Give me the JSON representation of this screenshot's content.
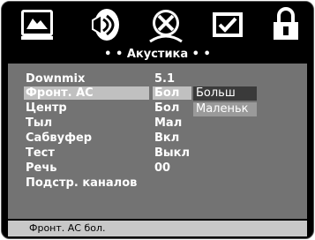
{
  "icon_bar": {
    "icons": [
      "picture-icon",
      "speaker-audio-icon",
      "disc-icon",
      "checkbox-icon",
      "lock-icon"
    ]
  },
  "menu": {
    "title": "• • Акустика • •",
    "items": [
      {
        "label": "Downmix",
        "value": "5.1"
      },
      {
        "label": "Фронт. АС",
        "value": "Бол"
      },
      {
        "label": "Центр",
        "value": "Бол"
      },
      {
        "label": "Тыл",
        "value": "Мал"
      },
      {
        "label": "Сабвуфер",
        "value": "Вкл"
      },
      {
        "label": "Тест",
        "value": "Выкл"
      },
      {
        "label": "Речь",
        "value": "00"
      },
      {
        "label": "Подстр. каналов",
        "value": ""
      }
    ],
    "options": [
      "Больш",
      "Маленьк"
    ]
  },
  "status": {
    "text": "Фронт. АС бол."
  },
  "colors": {
    "background": "#000000",
    "panel": "#737373",
    "selection": "#c0c0c0",
    "status_bar": "#c8c8c8"
  }
}
